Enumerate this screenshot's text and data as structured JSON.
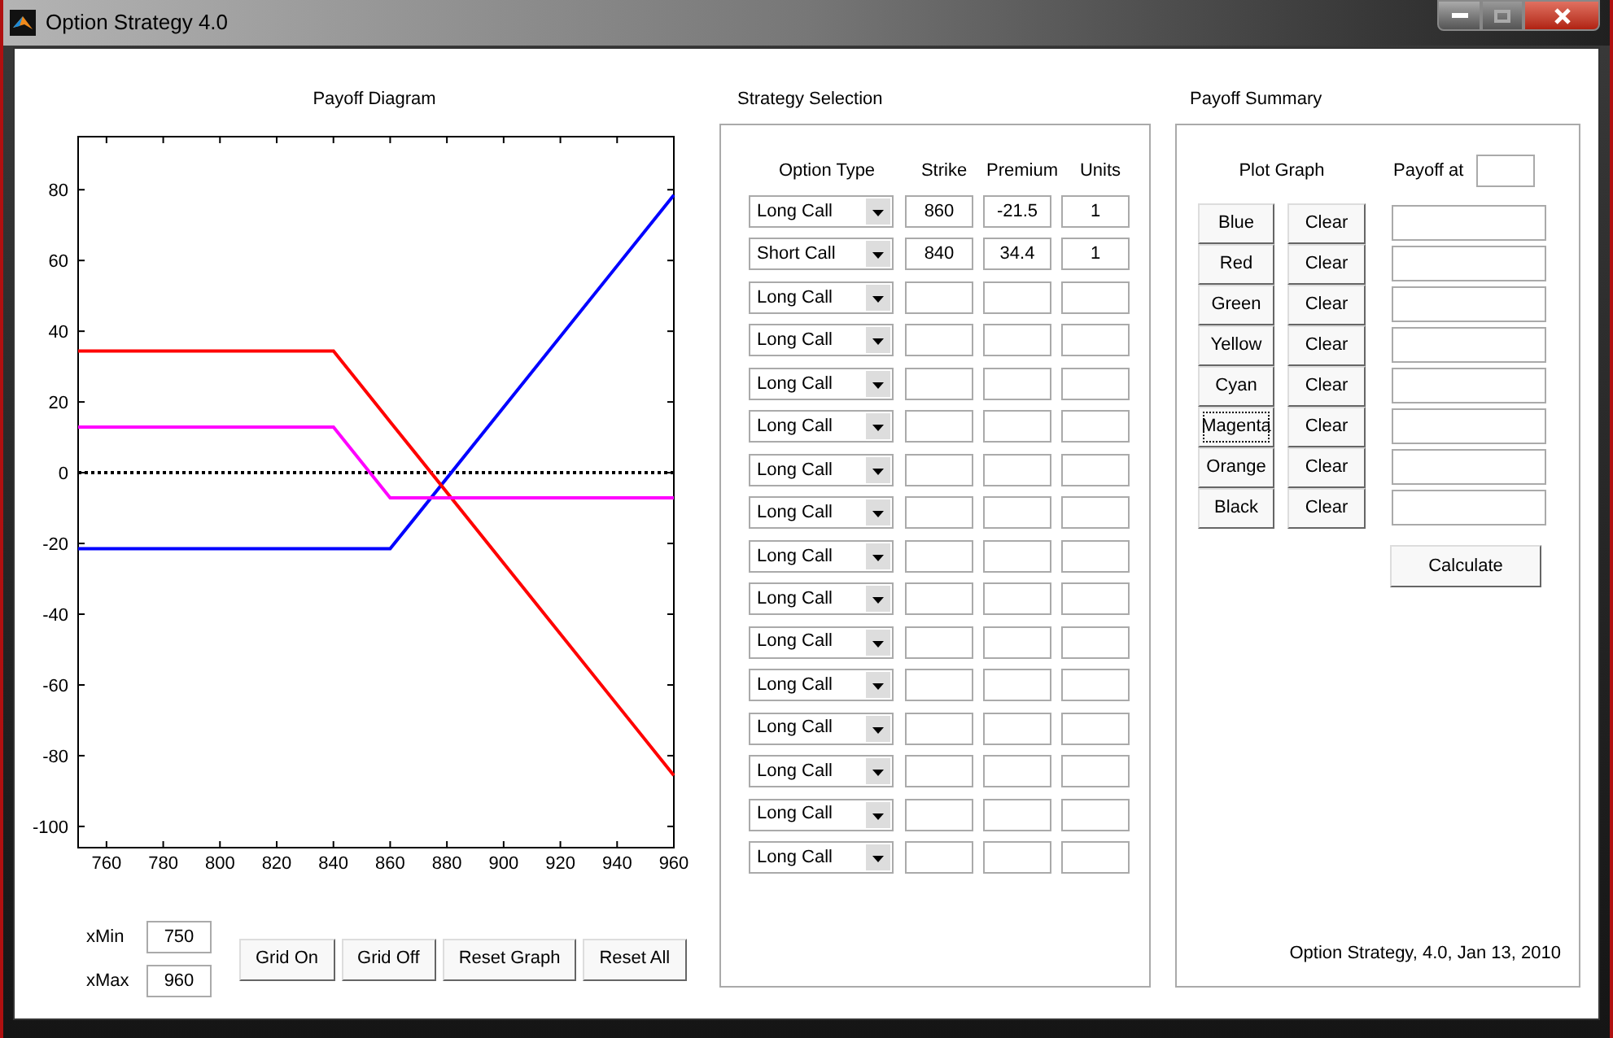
{
  "window": {
    "title": "Option Strategy 4.0"
  },
  "payoff_diagram": {
    "title": "Payoff Diagram",
    "chart_data": {
      "type": "line",
      "x": [
        750,
        840,
        860,
        960
      ],
      "series": [
        {
          "color": "#000000",
          "line_style": "dotted",
          "values": [
            0,
            0,
            0,
            0
          ]
        },
        {
          "color": "#0000ff",
          "values": [
            -21.5,
            -21.5,
            -21.5,
            78.5
          ]
        },
        {
          "color": "#ff0000",
          "values": [
            34.4,
            34.4,
            14.4,
            -85.6
          ]
        },
        {
          "color": "#ff00ff",
          "values": [
            12.9,
            12.9,
            -7.1,
            -7.1
          ]
        }
      ],
      "xlim": [
        750,
        960
      ],
      "ylim": [
        -106,
        95
      ],
      "xticks": [
        760,
        780,
        800,
        820,
        840,
        860,
        880,
        900,
        920,
        940,
        960
      ],
      "yticks": [
        -100,
        -80,
        -60,
        -40,
        -20,
        0,
        20,
        40,
        60,
        80
      ]
    }
  },
  "range": [
    {
      "label": "xMin",
      "value": "750"
    },
    {
      "label": "xMax",
      "value": "960"
    }
  ],
  "graph_buttons": [
    "Grid On",
    "Grid Off",
    "Reset Graph",
    "Reset All"
  ],
  "strategy_selection": {
    "title": "Strategy Selection",
    "columns": [
      "Option Type",
      "Strike",
      "Premium",
      "Units"
    ],
    "rows": [
      {
        "option_type": "Long Call",
        "strike": "860",
        "premium": "-21.5",
        "units": "1"
      },
      {
        "option_type": "Short Call",
        "strike": "840",
        "premium": "34.4",
        "units": "1"
      },
      {
        "option_type": "Long Call"
      },
      {
        "option_type": "Long Call"
      },
      {
        "option_type": "Long Call"
      },
      {
        "option_type": "Long Call"
      },
      {
        "option_type": "Long Call"
      },
      {
        "option_type": "Long Call"
      },
      {
        "option_type": "Long Call"
      },
      {
        "option_type": "Long Call"
      },
      {
        "option_type": "Long Call"
      },
      {
        "option_type": "Long Call"
      },
      {
        "option_type": "Long Call"
      },
      {
        "option_type": "Long Call"
      },
      {
        "option_type": "Long Call"
      },
      {
        "option_type": "Long Call"
      }
    ]
  },
  "payoff_summary": {
    "title": "Payoff Summary",
    "plot_graph_label": "Plot Graph",
    "payoff_at_label": "Payoff at",
    "plots": [
      {
        "label": "Blue",
        "focused": false,
        "clear": "Clear"
      },
      {
        "label": "Red",
        "focused": false,
        "clear": "Clear"
      },
      {
        "label": "Green",
        "focused": false,
        "clear": "Clear"
      },
      {
        "label": "Yellow",
        "focused": false,
        "clear": "Clear"
      },
      {
        "label": "Cyan",
        "focused": false,
        "clear": "Clear"
      },
      {
        "label": "Magenta",
        "focused": true,
        "clear": "Clear"
      },
      {
        "label": "Orange",
        "focused": false,
        "clear": "Clear"
      },
      {
        "label": "Black",
        "focused": false,
        "clear": "Clear"
      }
    ],
    "calculate": "Calculate"
  },
  "footer": "Option Strategy, 4.0, Jan 13, 2010"
}
